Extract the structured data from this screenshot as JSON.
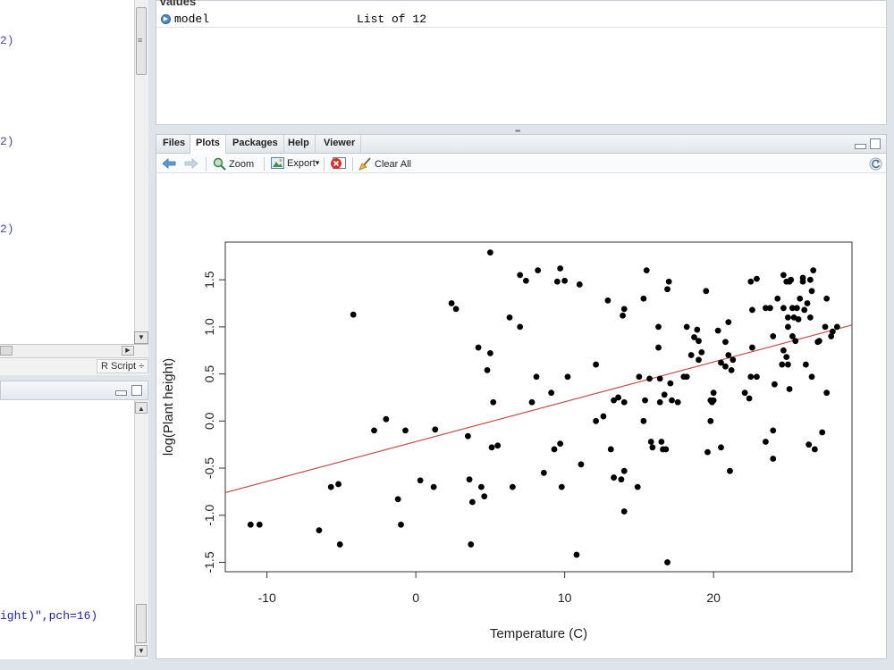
{
  "editor": {
    "fragments": [
      {
        "text": "2)",
        "top": 38
      },
      {
        "text": "2)",
        "top": 151
      },
      {
        "text": "2)",
        "top": 249
      }
    ],
    "script_type": "R Script ÷"
  },
  "console": {
    "fragment": "ight)\",pch=16)"
  },
  "environment": {
    "section_title": "Values",
    "rows": [
      {
        "name": "model",
        "value": "List of 12"
      }
    ]
  },
  "plots_pane": {
    "tabs": [
      "Files",
      "Plots",
      "Packages",
      "Help",
      "Viewer"
    ],
    "active_tab": "Plots",
    "toolbar": {
      "zoom": "Zoom",
      "export": "Export",
      "export_arrow": "▾",
      "clear_all": "Clear All"
    }
  },
  "colors": {
    "points": "#000000",
    "regression_line": "#c0504d"
  },
  "chart_data": {
    "type": "scatter",
    "title": "",
    "xlabel": "Temperature (C)",
    "ylabel": "log(Plant height)",
    "xlim": [
      -12.8,
      29.3
    ],
    "ylim": [
      -1.6,
      1.9
    ],
    "xticks": [
      -10,
      0,
      10,
      20
    ],
    "yticks": [
      -1.5,
      -1.0,
      -0.5,
      0.0,
      0.5,
      1.0,
      1.5
    ],
    "xtick_labels": [
      "-10",
      "0",
      "10",
      "20"
    ],
    "ytick_labels": [
      "-1.5",
      "-1.0",
      "-0.5",
      "0.0",
      "0.5",
      "1.0",
      "1.5"
    ],
    "grid": false,
    "legend": "none",
    "regression_line": {
      "x": [
        -12.8,
        29.3
      ],
      "y": [
        -0.76,
        1.02
      ]
    },
    "points": [
      [
        -11.1,
        -1.1
      ],
      [
        -10.5,
        -1.1
      ],
      [
        -6.5,
        -1.16
      ],
      [
        -5.7,
        -0.7
      ],
      [
        -5.2,
        -0.67
      ],
      [
        -5.1,
        -1.31
      ],
      [
        -4.2,
        1.13
      ],
      [
        -2.8,
        -0.1
      ],
      [
        -2.0,
        0.02
      ],
      [
        -1.2,
        -0.83
      ],
      [
        -1.0,
        -1.1
      ],
      [
        -0.7,
        -0.1
      ],
      [
        0.3,
        -0.63
      ],
      [
        1.2,
        -0.7
      ],
      [
        1.3,
        -0.09
      ],
      [
        2.4,
        1.25
      ],
      [
        2.7,
        1.19
      ],
      [
        3.5,
        -0.16
      ],
      [
        3.6,
        -0.62
      ],
      [
        3.8,
        -0.86
      ],
      [
        3.7,
        -1.31
      ],
      [
        4.2,
        0.78
      ],
      [
        4.4,
        -0.7
      ],
      [
        4.6,
        -0.8
      ],
      [
        4.8,
        0.54
      ],
      [
        5.0,
        0.72
      ],
      [
        5.0,
        1.79
      ],
      [
        5.2,
        0.2
      ],
      [
        5.1,
        -0.28
      ],
      [
        5.5,
        -0.26
      ],
      [
        6.3,
        1.1
      ],
      [
        6.5,
        -0.7
      ],
      [
        7.0,
        1.0
      ],
      [
        7.0,
        1.55
      ],
      [
        7.4,
        1.49
      ],
      [
        7.8,
        0.2
      ],
      [
        8.1,
        0.47
      ],
      [
        8.2,
        1.6
      ],
      [
        8.6,
        -0.55
      ],
      [
        9.1,
        0.3
      ],
      [
        9.3,
        -0.3
      ],
      [
        9.5,
        1.48
      ],
      [
        9.7,
        1.62
      ],
      [
        9.7,
        -0.24
      ],
      [
        9.8,
        -0.7
      ],
      [
        10.0,
        1.49
      ],
      [
        10.2,
        0.47
      ],
      [
        10.8,
        -1.42
      ],
      [
        11.0,
        1.45
      ],
      [
        11.1,
        -0.46
      ],
      [
        12.1,
        0.0
      ],
      [
        12.1,
        0.6
      ],
      [
        12.6,
        0.05
      ],
      [
        12.9,
        1.28
      ],
      [
        13.1,
        -0.3
      ],
      [
        13.3,
        -0.6
      ],
      [
        13.3,
        0.22
      ],
      [
        13.6,
        0.25
      ],
      [
        13.8,
        -0.62
      ],
      [
        13.9,
        1.12
      ],
      [
        14.0,
        1.19
      ],
      [
        14.0,
        0.2
      ],
      [
        14.0,
        -0.53
      ],
      [
        14.0,
        -0.96
      ],
      [
        14.9,
        -0.7
      ],
      [
        15.0,
        0.47
      ],
      [
        15.3,
        1.3
      ],
      [
        15.3,
        0.0
      ],
      [
        15.4,
        0.22
      ],
      [
        15.5,
        1.6
      ],
      [
        15.7,
        0.45
      ],
      [
        15.8,
        -0.22
      ],
      [
        15.9,
        -0.28
      ],
      [
        16.3,
        1.0
      ],
      [
        16.3,
        0.78
      ],
      [
        16.4,
        0.2
      ],
      [
        16.4,
        0.45
      ],
      [
        16.5,
        -0.22
      ],
      [
        16.6,
        -0.3
      ],
      [
        16.7,
        0.28
      ],
      [
        16.8,
        -0.3
      ],
      [
        16.9,
        1.4
      ],
      [
        17.0,
        1.48
      ],
      [
        17.1,
        0.4
      ],
      [
        17.2,
        0.22
      ],
      [
        16.9,
        -1.5
      ],
      [
        17.6,
        0.2
      ],
      [
        18.0,
        0.47
      ],
      [
        18.2,
        0.47
      ],
      [
        18.2,
        1.0
      ],
      [
        18.5,
        0.7
      ],
      [
        18.7,
        0.89
      ],
      [
        18.9,
        0.97
      ],
      [
        19.0,
        0.85
      ],
      [
        19.0,
        0.65
      ],
      [
        19.2,
        0.73
      ],
      [
        19.5,
        1.38
      ],
      [
        19.6,
        -0.33
      ],
      [
        19.8,
        0.22
      ],
      [
        19.8,
        0.0
      ],
      [
        19.9,
        0.2
      ],
      [
        20.0,
        0.3
      ],
      [
        20.0,
        0.22
      ],
      [
        20.3,
        0.96
      ],
      [
        20.5,
        -0.28
      ],
      [
        20.5,
        0.62
      ],
      [
        20.8,
        0.84
      ],
      [
        20.8,
        0.58
      ],
      [
        21.0,
        0.7
      ],
      [
        21.0,
        1.05
      ],
      [
        21.1,
        -0.53
      ],
      [
        21.2,
        0.54
      ],
      [
        21.3,
        0.65
      ],
      [
        22.1,
        0.3
      ],
      [
        22.4,
        0.24
      ],
      [
        22.5,
        0.47
      ],
      [
        22.5,
        1.48
      ],
      [
        22.6,
        0.78
      ],
      [
        22.6,
        1.18
      ],
      [
        22.9,
        1.51
      ],
      [
        22.9,
        0.47
      ],
      [
        23.5,
        1.2
      ],
      [
        23.5,
        -0.22
      ],
      [
        23.8,
        1.2
      ],
      [
        24.0,
        0.9
      ],
      [
        24.0,
        -0.1
      ],
      [
        24.0,
        -0.4
      ],
      [
        24.1,
        0.39
      ],
      [
        24.3,
        1.3
      ],
      [
        24.6,
        0.6
      ],
      [
        24.7,
        1.2
      ],
      [
        24.7,
        0.75
      ],
      [
        24.7,
        1.55
      ],
      [
        24.9,
        1.48
      ],
      [
        24.9,
        0.68
      ],
      [
        25.0,
        1.1
      ],
      [
        25.0,
        1.0
      ],
      [
        25.0,
        0.6
      ],
      [
        25.1,
        1.48
      ],
      [
        25.1,
        0.34
      ],
      [
        25.2,
        1.5
      ],
      [
        25.3,
        1.2
      ],
      [
        25.3,
        0.9
      ],
      [
        25.4,
        1.1
      ],
      [
        25.5,
        0.85
      ],
      [
        25.6,
        1.2
      ],
      [
        25.7,
        1.08
      ],
      [
        25.8,
        1.3
      ],
      [
        26.0,
        1.52
      ],
      [
        26.0,
        1.48
      ],
      [
        26.1,
        1.18
      ],
      [
        26.2,
        0.6
      ],
      [
        26.3,
        1.25
      ],
      [
        26.4,
        -0.25
      ],
      [
        26.5,
        1.1
      ],
      [
        26.5,
        1.5
      ],
      [
        26.6,
        1.38
      ],
      [
        26.6,
        0.47
      ],
      [
        26.7,
        1.6
      ],
      [
        26.8,
        -0.3
      ],
      [
        27.0,
        0.84
      ],
      [
        27.1,
        0.85
      ],
      [
        27.3,
        -0.12
      ],
      [
        27.5,
        1.0
      ],
      [
        27.6,
        1.3
      ],
      [
        27.6,
        0.3
      ],
      [
        27.9,
        0.9
      ],
      [
        28.0,
        0.95
      ],
      [
        28.3,
        1.0
      ]
    ]
  }
}
